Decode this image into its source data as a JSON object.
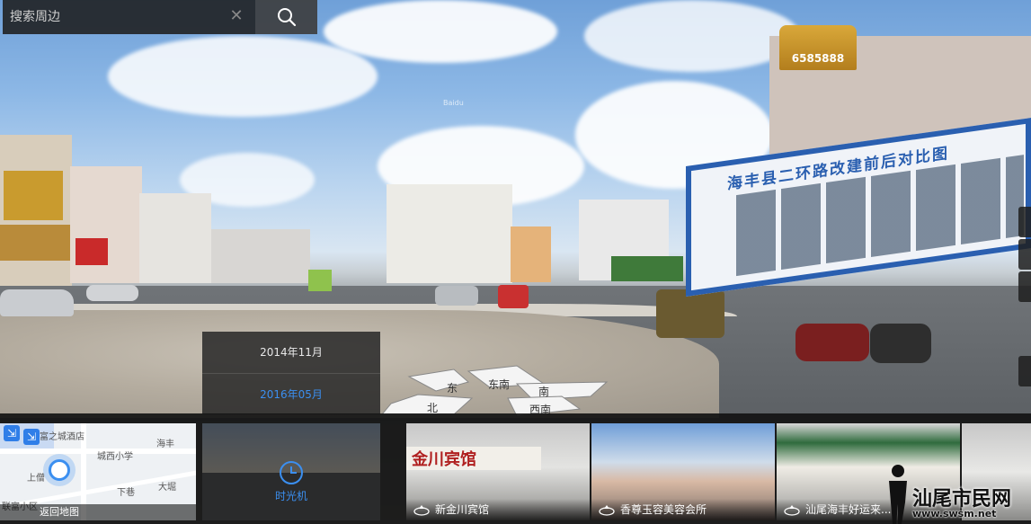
{
  "search": {
    "placeholder": "搜索周边",
    "clear_icon": "close-icon",
    "button_icon": "search-icon"
  },
  "scene": {
    "watermark": "Baidu",
    "hotel_sign": "6585888",
    "billboard_title": "海丰县二环路改建前后对比图"
  },
  "time_machine": {
    "dates": [
      "2014年11月",
      "2016年05月"
    ],
    "selected": "2016年05月",
    "label": "时光机"
  },
  "compass": {
    "labels": [
      "东",
      "东南",
      "南",
      "北",
      "西南"
    ]
  },
  "minimap": {
    "labels": [
      "富之城酒店",
      "海丰",
      "城西小学",
      "上僧",
      "下巷",
      "大堀",
      "联富小区"
    ],
    "footer": "返回地图"
  },
  "thumbnails": [
    {
      "caption": "新金川宾馆",
      "sign": "金川宾馆"
    },
    {
      "caption": "香尊玉容美容会所"
    },
    {
      "caption": "汕尾海丰好运来..."
    }
  ],
  "site_logo": {
    "text": "汕尾市民网",
    "url": "www.swsm.net"
  },
  "colors": {
    "accent": "#3b8ff0",
    "panel": "#282828"
  }
}
